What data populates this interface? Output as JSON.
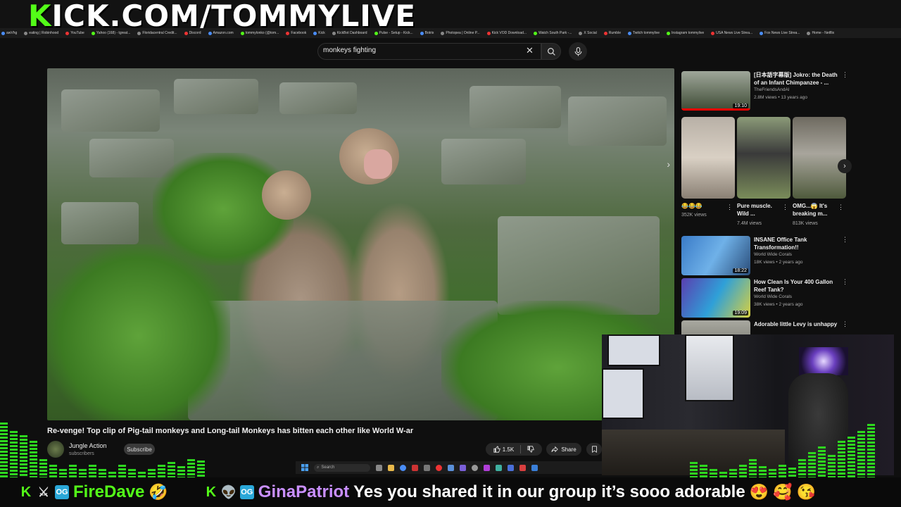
{
  "stream": {
    "url_prefix": "K",
    "url_rest": "ICK.COM/TOMMYLIVE"
  },
  "bookmarks": [
    "awVhg",
    "eating | Robinhood",
    "YouTube",
    "Yahoo (168) - tgreat...",
    "Floridacentral Credit...",
    "Discord",
    "Amazon.com",
    "tommylonko (@tom...",
    "Facebook",
    "Kick",
    "KickBot Dashboard",
    "Pulse - Setup - Kick...",
    "Botrix",
    "Photopea | Online P...",
    "Kick VOD Download...",
    "Watch South Park -...",
    "X Social",
    "Rumble",
    "Twitch tommylive",
    "Instagram tommylive",
    "USA News Live Strea...",
    "Fox News Live Strea...",
    "Home - Netflix"
  ],
  "search": {
    "value": "monkeys fighting"
  },
  "video": {
    "title": "Re-venge! Top clip of Pig-tail monkeys and Long-tail Monkeys has bitten each other like World W-ar",
    "channel": "Jungle Action",
    "subscribers": "subscribers",
    "subscribe_label": "Subscribe",
    "likes": "1.5K",
    "share_label": "Share"
  },
  "recommendations": [
    {
      "title": "[日本語字幕版] Jokro: the Death of an Infant Chimpanzee - ...",
      "channel": "TheFriendsAndAl",
      "meta": "2.8M views • 13 years ago",
      "duration": "19:10"
    },
    {
      "title": "INSANE Office Tank Transformation!!",
      "channel": "World Wide Corals",
      "meta": "18K views • 2 years ago",
      "duration": "18:22"
    },
    {
      "title": "How Clean Is Your 400 Gallon Reef Tank?",
      "channel": "World Wide Corals",
      "meta": "38K views • 2 years ago",
      "duration": "19:09"
    },
    {
      "title": "Adorable little Levy is unhappy",
      "channel": "",
      "meta": "",
      "duration": ""
    }
  ],
  "shorts": [
    {
      "title": "😂😂😂",
      "views": "352K views"
    },
    {
      "title": "Pure muscle. Wild ...",
      "views": "7.4M views"
    },
    {
      "title": "OMG...😱 It's breaking m...",
      "views": "813K views"
    }
  ],
  "taskbar": {
    "search_label": "Search"
  },
  "chat": [
    {
      "user": "FireDave",
      "user_color": "#53fc18",
      "message": "",
      "emoji": "🤣"
    },
    {
      "user": "GinaPatriot",
      "user_color": "#c98fff",
      "message": "Yes you shared it in our group it’s sooo adorable",
      "emoji": "😍 🥰 😘"
    }
  ],
  "colors": {
    "kick_green": "#53fc18",
    "yt_bg": "#0f0f0f"
  }
}
